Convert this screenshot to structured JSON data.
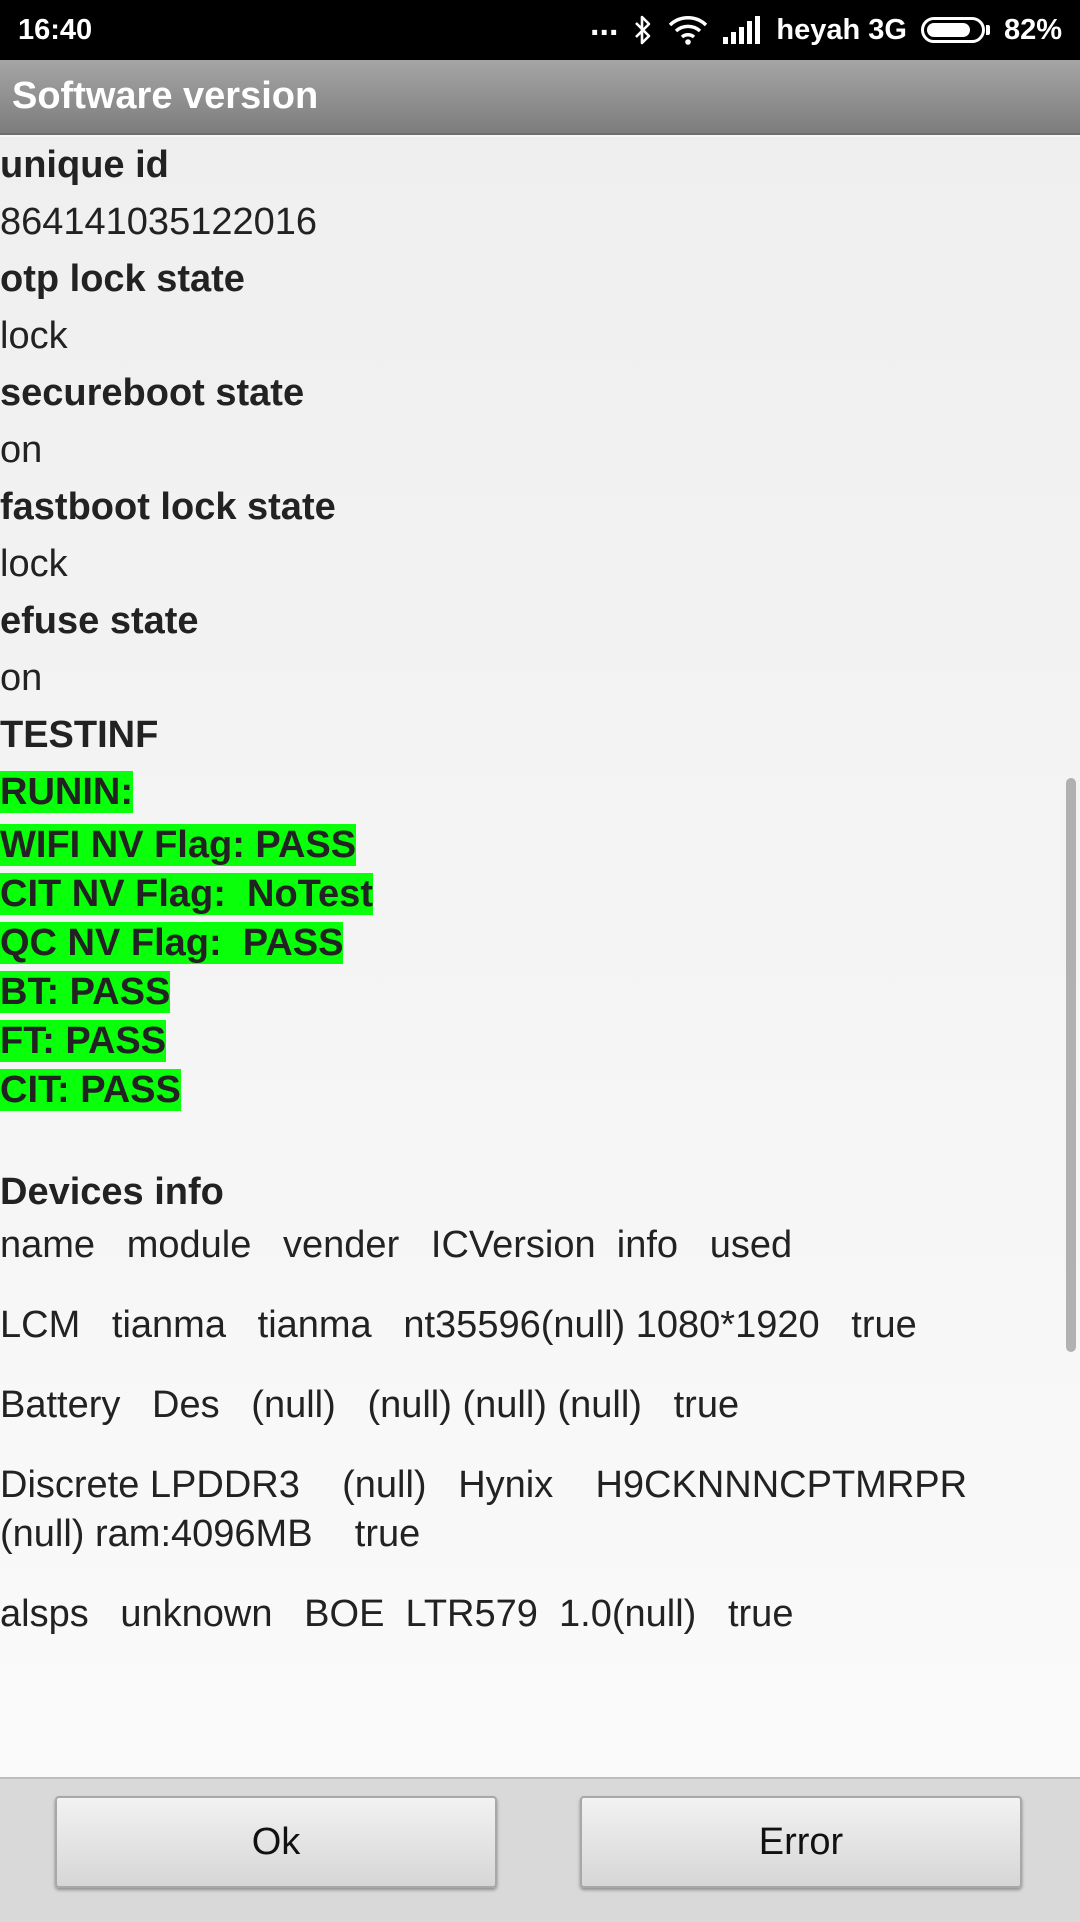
{
  "status_bar": {
    "time": "16:40",
    "dots": "...",
    "carrier": "heyah 3G",
    "battery_percent": "82%",
    "battery_level": 0.82
  },
  "title": "Software version",
  "fields": [
    {
      "label": "unique id",
      "value": "864141035122016"
    },
    {
      "label": "otp lock state",
      "value": "lock"
    },
    {
      "label": "secureboot state",
      "value": "on"
    },
    {
      "label": "fastboot lock state",
      "value": "lock"
    },
    {
      "label": "efuse state",
      "value": "on"
    }
  ],
  "testinf_label": "TESTINF",
  "runin": {
    "header": "RUNIN:",
    "lines": [
      "WIFI NV Flag: PASS",
      "CIT NV Flag:  NoTest",
      "QC NV Flag:  PASS",
      "BT: PASS",
      "FT: PASS",
      "CIT: PASS"
    ]
  },
  "devices": {
    "header": "Devices info",
    "columns_line": "name   module   vender   ICVersion  info   used",
    "lines": [
      "LCM   tianma   tianma   nt35596(null) 1080*1920   true",
      "Battery   Des   (null)   (null) (null) (null)   true",
      "Discrete LPDDR3    (null)   Hynix    H9CKNNNCPTMRPR",
      "(null) ram:4096MB    true",
      "alsps   unknown   BOE  LTR579  1.0(null)   true"
    ]
  },
  "buttons": {
    "ok": "Ok",
    "error": "Error"
  },
  "colors": {
    "highlight": "#0aff0a",
    "status_bar": "#000000",
    "title_bar": "#8e8e8e"
  }
}
